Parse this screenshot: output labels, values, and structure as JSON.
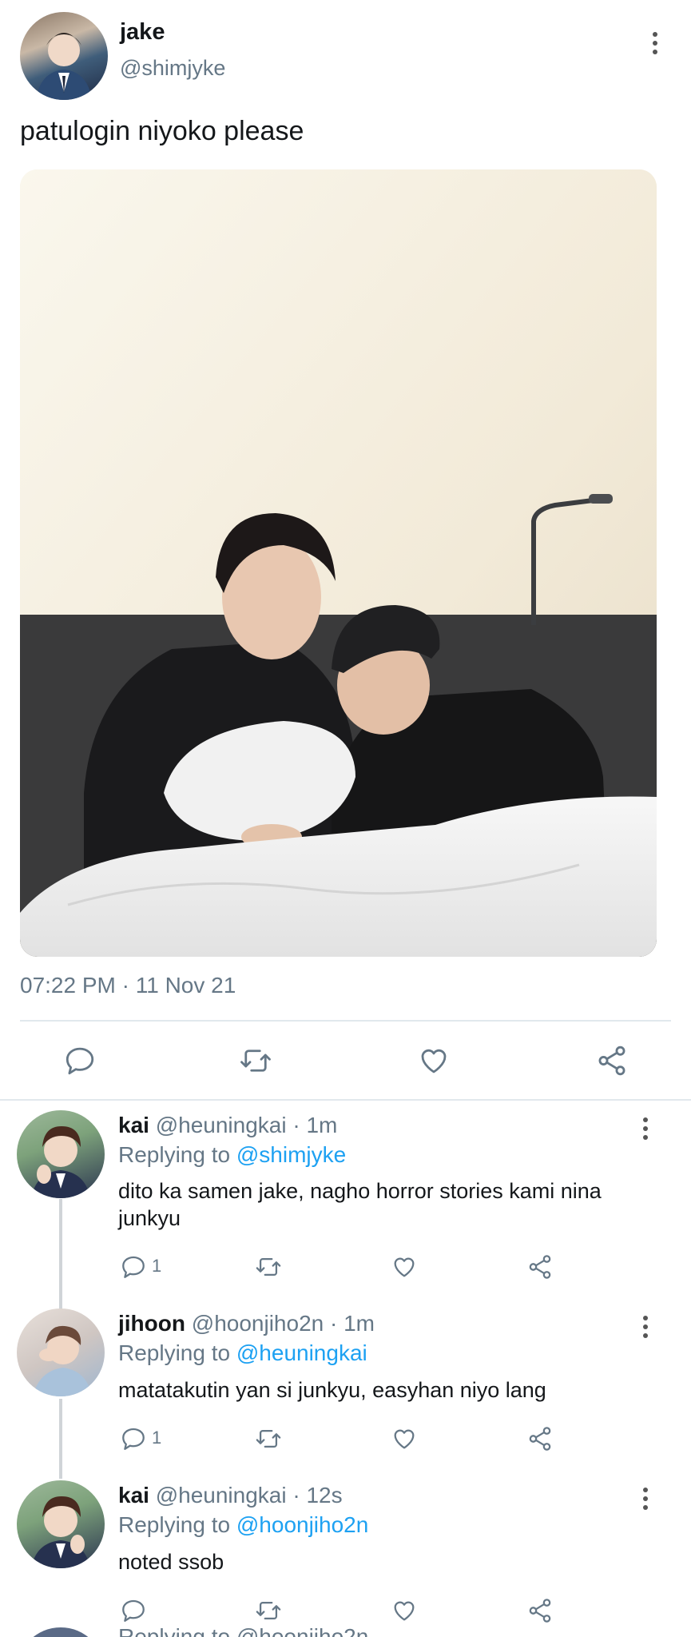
{
  "tweet": {
    "author_name": "jake",
    "author_handle": "@shimjyke",
    "text": "patulogin niyoko please",
    "timestamp": "07:22 PM · 11 Nov 21"
  },
  "replies": [
    {
      "name": "kai",
      "handle": "@heuningkai · 1m",
      "replying_label": "Replying to",
      "replying_to": "@shimjyke",
      "text": "dito ka samen jake, nagho horror stories kami nina junkyu",
      "reply_count": "1"
    },
    {
      "name": "jihoon",
      "handle": "@hoonjiho2n · 1m",
      "replying_label": "Replying to",
      "replying_to": "@heuningkai",
      "text": "matatakutin yan si junkyu, easyhan niyo lang",
      "reply_count": "1"
    },
    {
      "name": "kai",
      "handle": "@heuningkai · 12s",
      "replying_label": "Replying to",
      "replying_to": "@hoonjiho2n",
      "text": "noted ssob",
      "reply_count": ""
    }
  ],
  "partial_next_reply": "Replying to @hoonjiho2n",
  "colors": {
    "link": "#1da1f2",
    "muted": "#657786",
    "divider": "#e1e8ed"
  },
  "icons": [
    "more-vert-icon",
    "reply-icon",
    "retweet-icon",
    "like-icon",
    "share-icon"
  ]
}
